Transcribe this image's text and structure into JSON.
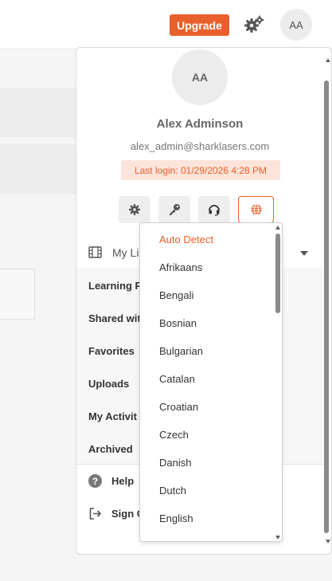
{
  "header": {
    "upgrade_label": "Upgrade",
    "settings_icon": "gears-icon",
    "avatar_initials": "AA"
  },
  "profile": {
    "avatar_initials": "AA",
    "name": "Alex Adminson",
    "email": "alex_admin@sharklasers.com",
    "last_login": "Last login: 01/29/2026 4:28 PM",
    "actions": [
      {
        "name": "settings",
        "icon": "gear-icon"
      },
      {
        "name": "password",
        "icon": "key-icon"
      },
      {
        "name": "support",
        "icon": "headset-icon"
      },
      {
        "name": "language",
        "icon": "globe-icon"
      }
    ]
  },
  "library": {
    "label": "My Lil",
    "items": [
      "Learning P",
      "Shared wit",
      "Favorites",
      "Uploads",
      "My Activit",
      "Archived"
    ]
  },
  "bottom": {
    "help": "Help",
    "sign_out": "Sign C"
  },
  "language_dropdown": {
    "selected": "Auto Detect",
    "options": [
      "Auto Detect",
      "Afrikaans",
      "Bengali",
      "Bosnian",
      "Bulgarian",
      "Catalan",
      "Croatian",
      "Czech",
      "Danish",
      "Dutch",
      "English"
    ]
  },
  "colors": {
    "accent": "#e8602c",
    "last_login_bg": "#fde4da"
  }
}
